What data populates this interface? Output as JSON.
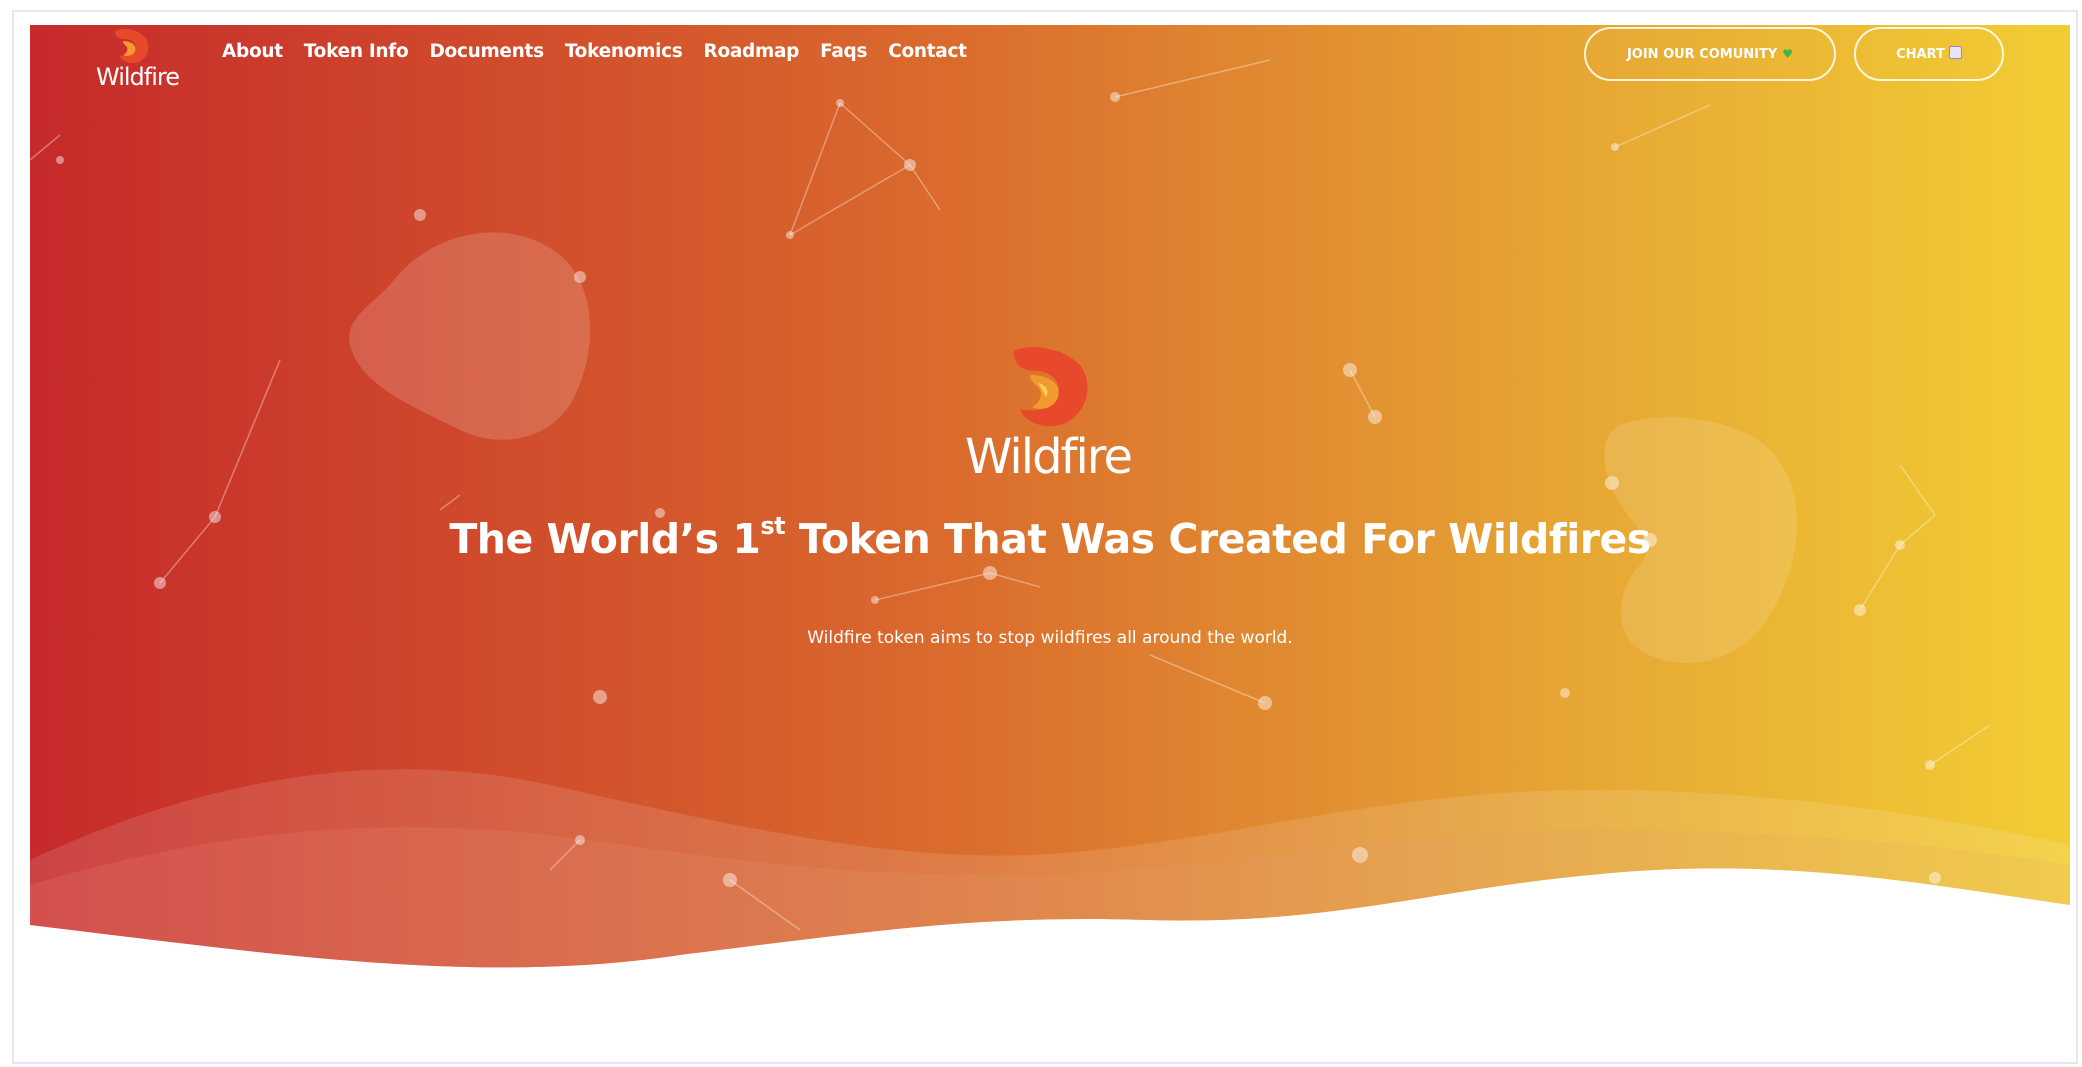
{
  "brand": {
    "name": "Wildfire"
  },
  "nav": {
    "items": [
      {
        "label": "About"
      },
      {
        "label": "Token Info"
      },
      {
        "label": "Documents"
      },
      {
        "label": "Tokenomics"
      },
      {
        "label": "Roadmap"
      },
      {
        "label": "Faqs"
      },
      {
        "label": "Contact"
      }
    ],
    "community_button": "JOIN OUR COMUNITY",
    "community_icon": "heart-icon",
    "chart_button": "CHART",
    "chart_icon": "chart-icon"
  },
  "hero": {
    "title_pre": "The World’s 1",
    "title_sup": "st",
    "title_post": " Token That Was Created For Wildfires",
    "subtitle": "Wildfire token aims to stop wildfires all around the world."
  },
  "colors": {
    "gradient_start": "#c7292a",
    "gradient_mid": "#dd7a2e",
    "gradient_end": "#f1cb33",
    "heart": "#3cb54a"
  }
}
